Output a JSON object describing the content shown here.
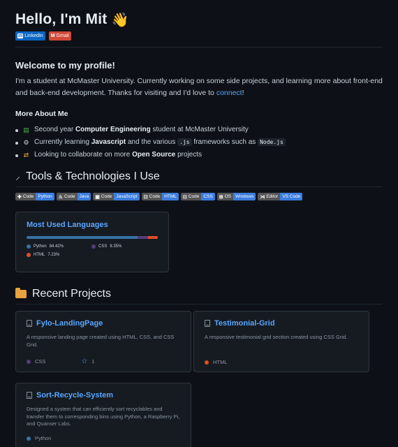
{
  "header": {
    "title": "Hello, I'm Mit",
    "wave_icon": "waving-hand-icon",
    "social": [
      {
        "icon": "in",
        "label": "LinkedIn",
        "color": "#0a66c2"
      },
      {
        "icon": "M",
        "label": "Gmail",
        "color": "#d14836"
      }
    ]
  },
  "welcome": {
    "heading": "Welcome to my profile!",
    "intro_text": "I'm a student at McMaster University. Currently working on some side projects, and learning more about front-end and back-end development. Thanks for visiting and I'd love to ",
    "intro_link": "connect",
    "intro_end": "!"
  },
  "more": {
    "heading": "More About Me",
    "items": [
      {
        "pre": "Second year ",
        "bold": "Computer Engineering",
        "post": " student at McMaster University"
      },
      {
        "pre": "Currently learning ",
        "bold": "Javascript",
        "mid": " and the various ",
        "code1": ".js",
        "mid2": " frameworks such as ",
        "code2": "Node.js"
      },
      {
        "pre": "Looking to collaborate on more ",
        "bold": "Open Source",
        "post": " projects"
      }
    ]
  },
  "tools": {
    "heading": "Tools & Technologies I Use",
    "badges": [
      {
        "left": "Code",
        "right": "Python"
      },
      {
        "left": "Code",
        "right": "Java"
      },
      {
        "left": "Code",
        "right": "JavaScript"
      },
      {
        "left": "Code",
        "right": "HTML"
      },
      {
        "left": "Code",
        "right": "CSS"
      },
      {
        "left": "OS",
        "right": "Windows"
      },
      {
        "left": "Editor",
        "right": "VS Code"
      }
    ]
  },
  "languages_card": {
    "title": "Most Used Languages",
    "langs": [
      {
        "name": "Python",
        "percent": "84.42%",
        "value": 84.42,
        "color": "#3572a5"
      },
      {
        "name": "CSS",
        "percent": "8.35%",
        "value": 8.35,
        "color": "#563d7c"
      },
      {
        "name": "HTML",
        "percent": "7.23%",
        "value": 7.23,
        "color": "#e34c26"
      }
    ]
  },
  "projects": {
    "heading": "Recent Projects",
    "items": [
      {
        "name": "Fylo-LandingPage",
        "desc": "A responsive landing page created using HTML, CSS, and CSS Grid.",
        "lang": "CSS",
        "lang_color": "#563d7c",
        "stars": "1"
      },
      {
        "name": "Testimonial-Grid",
        "desc": "A responsive testimonial grid section created using CSS Grid.",
        "lang": "HTML",
        "lang_color": "#e34c26",
        "stars": ""
      },
      {
        "name": "Sort-Recycle-System",
        "desc": "Designed a system that can efficiently sort recyclables and transfer them to corresponding bins using Python, a Raspberry Pi, and Quanser Labs.",
        "lang": "Python",
        "lang_color": "#3572a5",
        "stars": ""
      }
    ]
  }
}
